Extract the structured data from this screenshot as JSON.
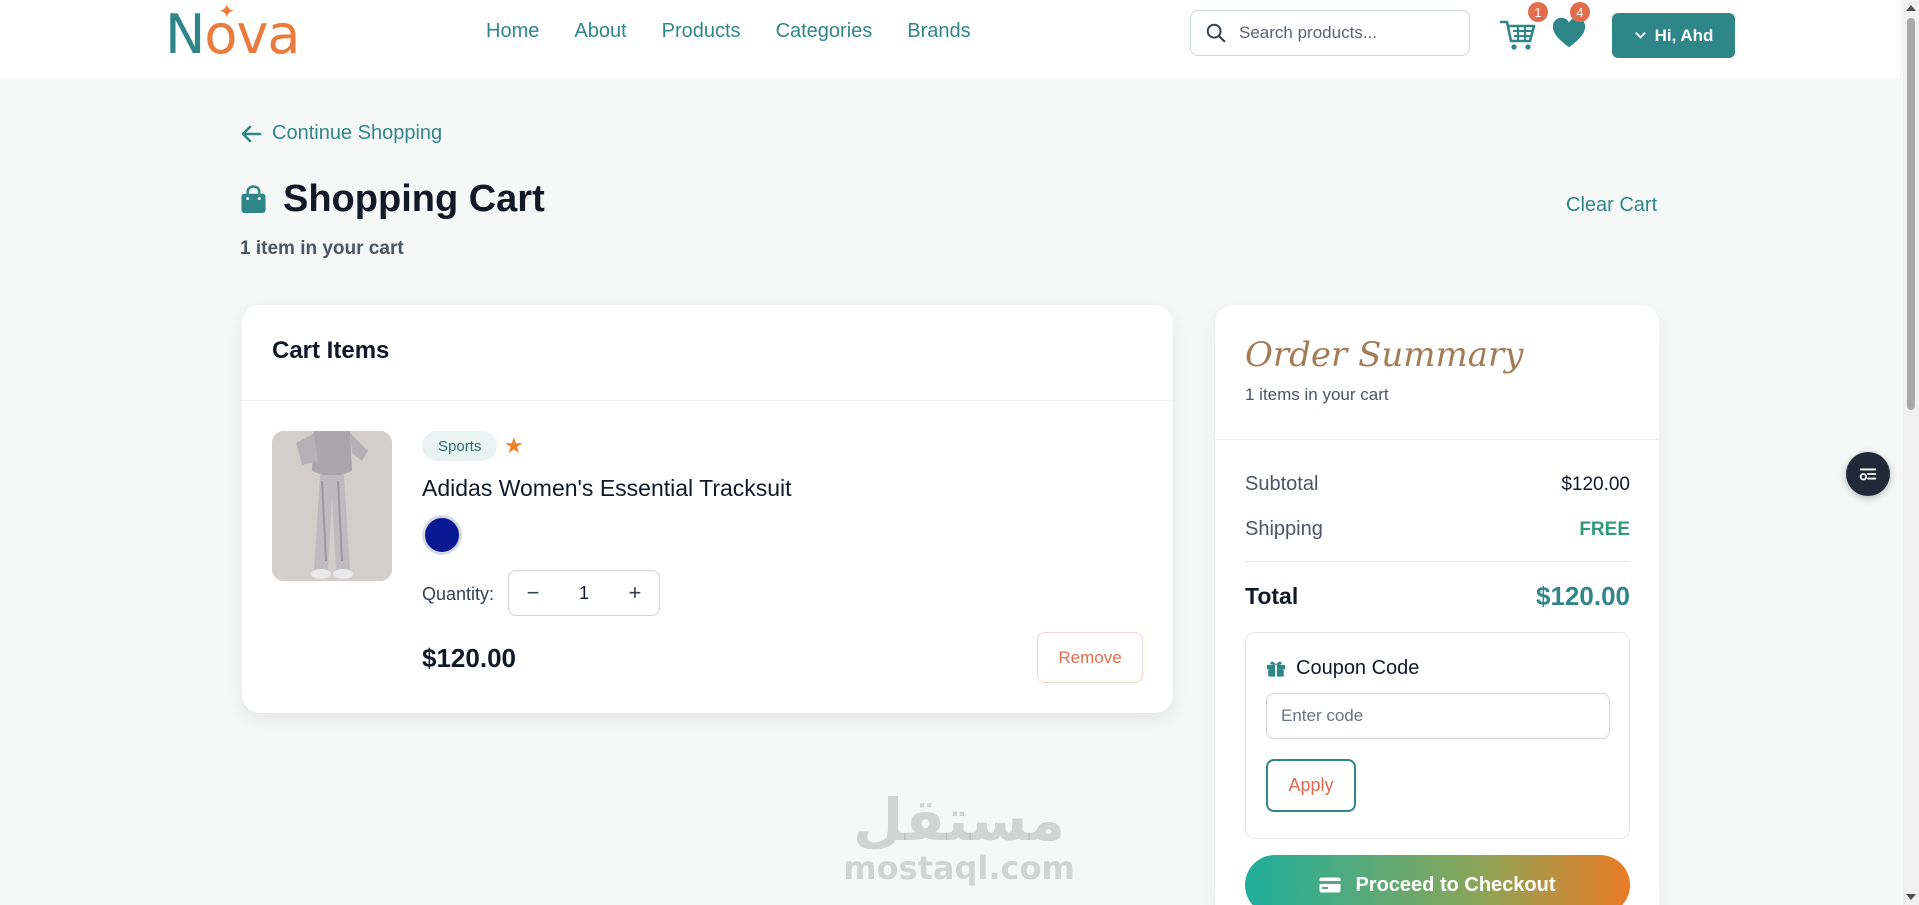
{
  "header": {
    "logo": {
      "first": "N",
      "o": "o",
      "rest": "va"
    },
    "nav": [
      "Home",
      "About",
      "Products",
      "Categories",
      "Brands"
    ],
    "search_placeholder": "Search products...",
    "cart_count": "1",
    "wishlist_count": "4",
    "user_label": "Hi, Ahd"
  },
  "page": {
    "continue_label": "Continue Shopping",
    "title": "Shopping Cart",
    "item_count_text": "1 item in your cart",
    "clear_cart_label": "Clear Cart"
  },
  "cart": {
    "heading": "Cart Items",
    "items": [
      {
        "category": "Sports",
        "name": "Adidas Women's Essential Tracksuit",
        "color": "#0b1894",
        "quantity_label": "Quantity:",
        "quantity": "1",
        "price": "$120.00",
        "remove_label": "Remove"
      }
    ]
  },
  "summary": {
    "title": "Order Summary",
    "subtitle": "1 items in your cart",
    "subtotal_label": "Subtotal",
    "subtotal_value": "$120.00",
    "shipping_label": "Shipping",
    "shipping_value": "FREE",
    "total_label": "Total",
    "total_value": "$120.00",
    "coupon_title": "Coupon Code",
    "coupon_placeholder": "Enter code",
    "apply_label": "Apply",
    "checkout_label": "Proceed to Checkout"
  },
  "watermark": {
    "arabic": "مستقل",
    "latin": "mostaql.com"
  },
  "colors": {
    "brand_teal": "#2f8688",
    "brand_orange": "#e97b3c",
    "remove_red": "#e26d4e"
  }
}
